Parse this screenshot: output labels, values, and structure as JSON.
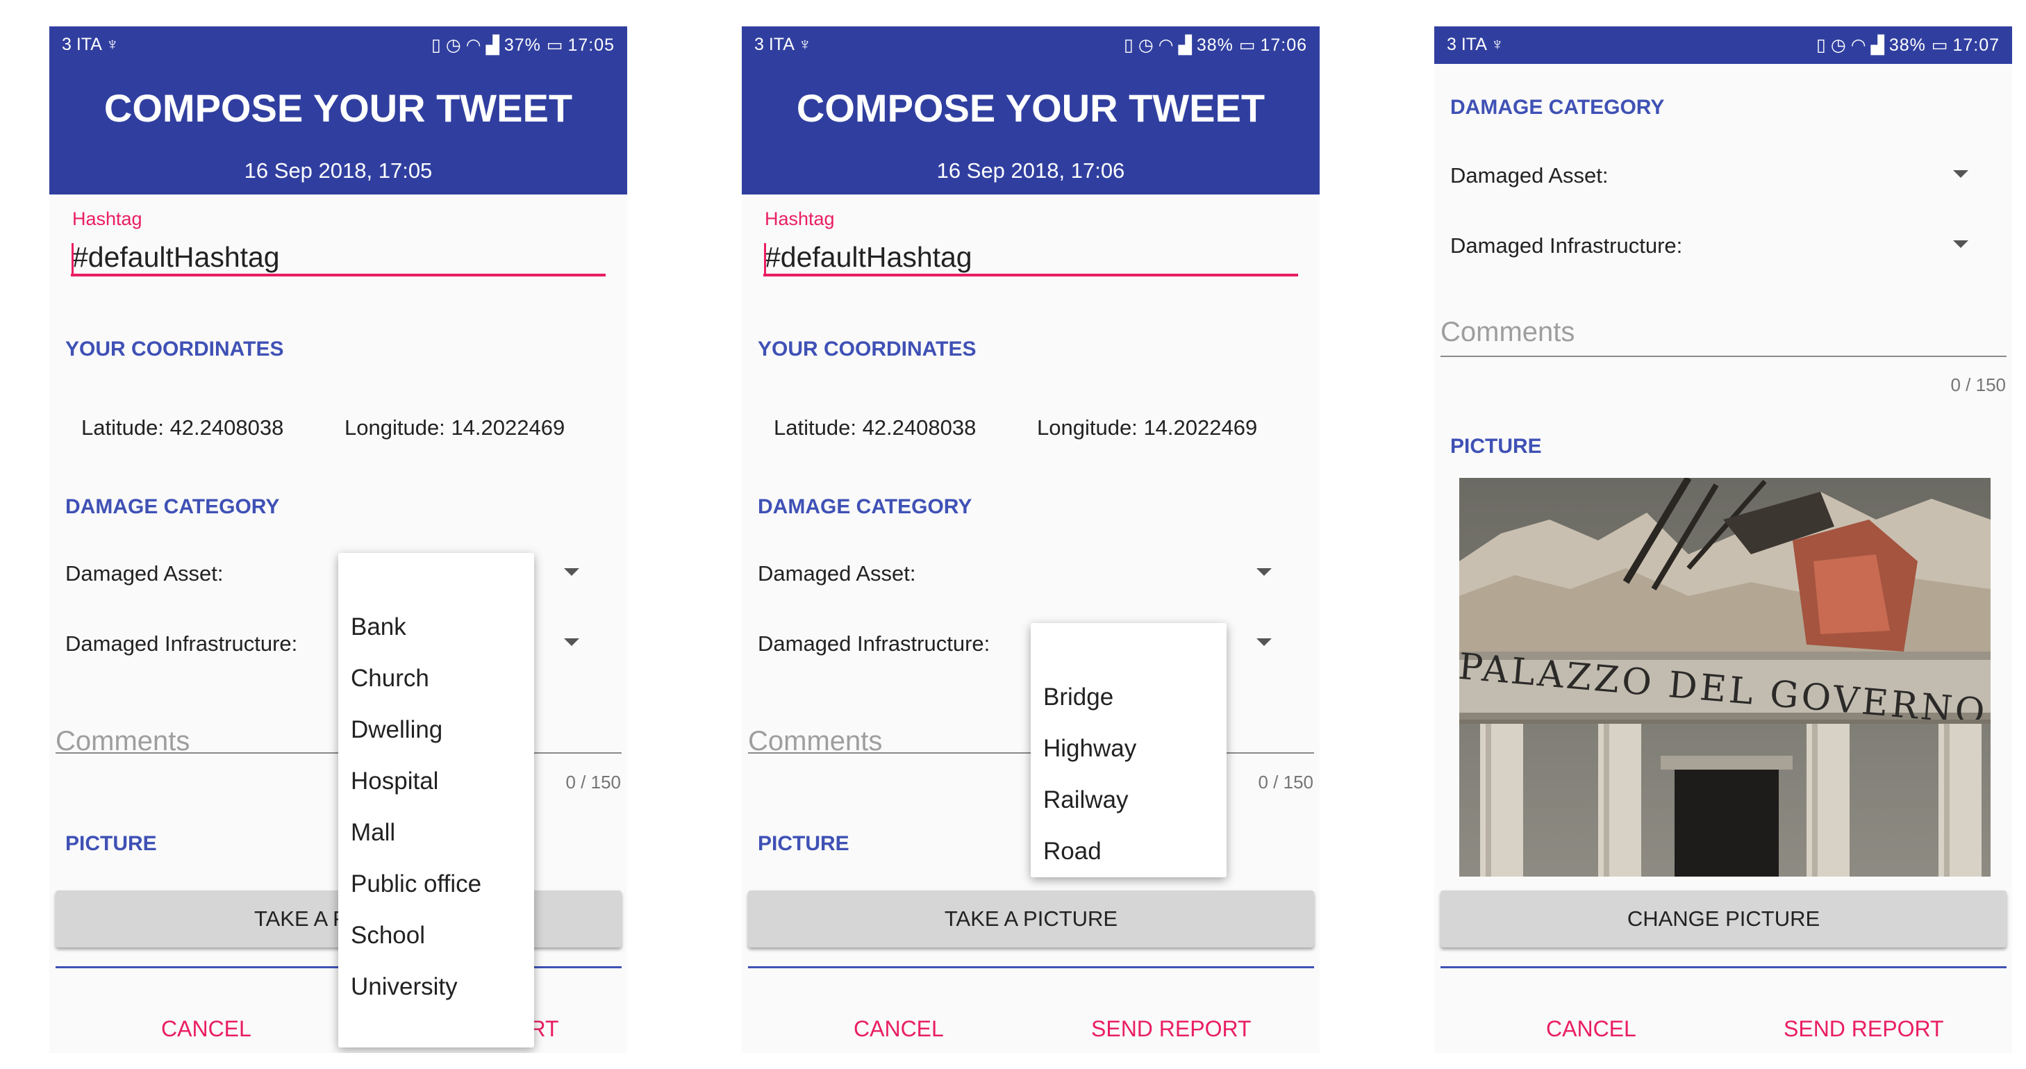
{
  "status_bars": [
    {
      "carrier": "3 ITA ♆",
      "battery": "37%",
      "time": "17:05"
    },
    {
      "carrier": "3 ITA ♆",
      "battery": "38%",
      "time": "17:06"
    },
    {
      "carrier": "3 ITA ♆",
      "battery": "38%",
      "time": "17:07"
    }
  ],
  "screens": [
    {
      "title": "COMPOSE YOUR TWEET",
      "datetime": "16 Sep 2018, 17:05"
    },
    {
      "title": "COMPOSE YOUR TWEET",
      "datetime": "16 Sep 2018, 17:06"
    }
  ],
  "form": {
    "hashtag_label": "Hashtag",
    "hashtag_value": "#defaultHashtag",
    "coordinates_heading": "YOUR COORDINATES",
    "latitude_label": "Latitude:",
    "latitude_value": "42.2408038",
    "longitude_label": "Longitude:",
    "longitude_value": "14.2022469",
    "damage_heading": "DAMAGE CATEGORY",
    "asset_label": "Damaged Asset:",
    "infrastructure_label": "Damaged Infrastructure:",
    "comments_placeholder": "Comments",
    "counter": "0 / 150",
    "picture_heading": "PICTURE",
    "take_picture": "TAKE A PICTURE",
    "take_picture_partial": "TAKE A P",
    "change_picture": "CHANGE PICTURE",
    "cancel": "CANCEL",
    "send_report": "SEND REPORT"
  },
  "asset_options": [
    "Bank",
    "Church",
    "Dwelling",
    "Hospital",
    "Mall",
    "Public office",
    "School",
    "University"
  ],
  "infrastructure_options": [
    "Bridge",
    "Highway",
    "Railway",
    "Road"
  ],
  "photo": {
    "inscription": "PALAZZO DEL GOVERNO"
  },
  "colors": {
    "primary": "#303f9f",
    "accent": "#e91e63",
    "section": "#3f51b5"
  },
  "icons": [
    "vibrate-icon",
    "alarm-icon",
    "wifi-icon",
    "signal-icon",
    "battery-icon"
  ]
}
